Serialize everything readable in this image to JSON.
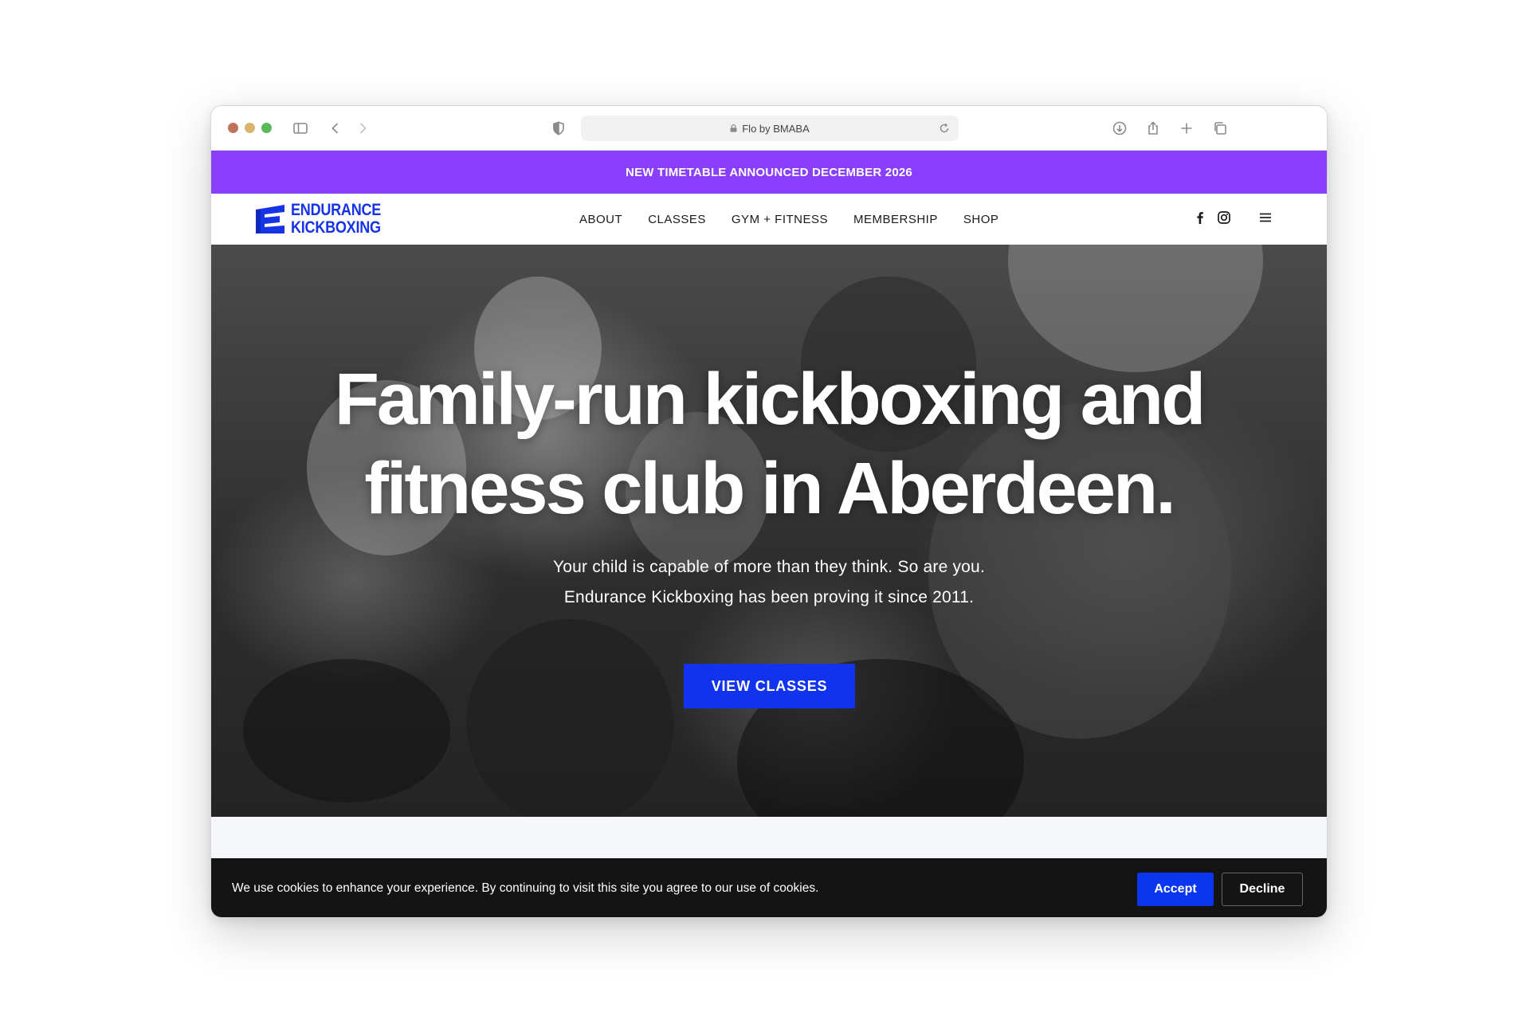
{
  "browser": {
    "address": "Flo by BMABA",
    "icons": [
      "sidebar-icon",
      "back-icon",
      "forward-icon",
      "shield-icon",
      "lock-icon",
      "reload-icon",
      "download-icon",
      "share-icon",
      "new-tab-icon",
      "tabs-icon"
    ]
  },
  "announcement": {
    "text": "NEW TIMETABLE ANNOUNCED DECEMBER 2026",
    "color": "#8a3ffc"
  },
  "nav": {
    "logo_line1": "ENDURANCE",
    "logo_line2": "KICKBOXING",
    "brand_color": "#1733e6",
    "links": [
      {
        "label": "ABOUT"
      },
      {
        "label": "CLASSES"
      },
      {
        "label": "GYM + FITNESS"
      },
      {
        "label": "MEMBERSHIP"
      },
      {
        "label": "SHOP"
      }
    ],
    "icons": [
      "facebook-icon",
      "instagram-icon",
      "menu-icon"
    ]
  },
  "hero": {
    "title_line1": "Family-run kickboxing and",
    "title_line2": "fitness club in Aberdeen.",
    "subtitle_line1": "Your child is capable of more than they think. So are you.",
    "subtitle_line2": "Endurance Kickboxing has been proving it since 2011.",
    "cta_label": "VIEW CLASSES",
    "cta_color": "#1133ee"
  },
  "cookie": {
    "text": "We use cookies to enhance your experience. By continuing to visit this site you agree to our use of cookies.",
    "accept_label": "Accept",
    "decline_label": "Decline",
    "accept_color": "#0a36f0"
  }
}
